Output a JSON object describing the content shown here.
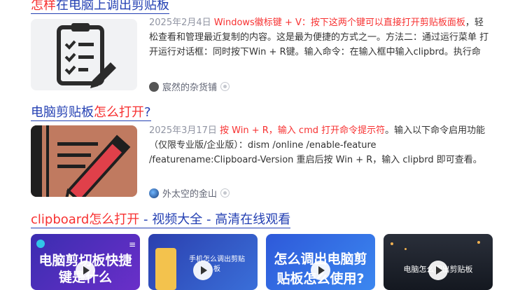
{
  "results": [
    {
      "title_hl": "怎样",
      "title_rest": "在电脑上调出剪贴板",
      "date": "2025年2月4日",
      "snippet_red": "Windows徽标键 + V：按下这两个键可以直接打开剪贴板面板",
      "snippet_rest": "，轻松查看和管理最近复制的内容。这是最为便捷的方式之一。方法二：通过运行菜单 打开运行对话框：同时按下Win + R键。输入命令：在输入框中输入clipbrd。执行命令：按...",
      "source": "宸然的杂货铺"
    },
    {
      "title_pre": "电脑剪贴板",
      "title_hl": "怎么打开",
      "title_post": "?",
      "date": "2025年3月17日",
      "snippet_red": "按 Win + R，输入 cmd 打开命令提示符",
      "snippet_rest": "。输入以下命令启用功能（仅限专业版/企业版）：dism /online /enable-feature /featurename:Clipboard-Version 重启后按 Win + R，输入 clipbrd 即可查看。二、macOS 系统 1. 查看最近一次复制的...",
      "source": "外太空的金山"
    }
  ],
  "video_section": {
    "title_hl": "clipboard怎么打开",
    "title_rest": " - 视频大全 - 高清在线观看",
    "cards": [
      {
        "text": "电脑剪切板快捷键是什么"
      },
      {
        "text": "手机怎么调出剪贴板"
      },
      {
        "text": "怎么调出电脑剪贴板怎么使用?"
      },
      {
        "text": "电脑怎么调出剪贴板"
      }
    ]
  },
  "colors": {
    "link": "#2440b3",
    "highlight": "#f73131",
    "meta": "#9195a3"
  }
}
